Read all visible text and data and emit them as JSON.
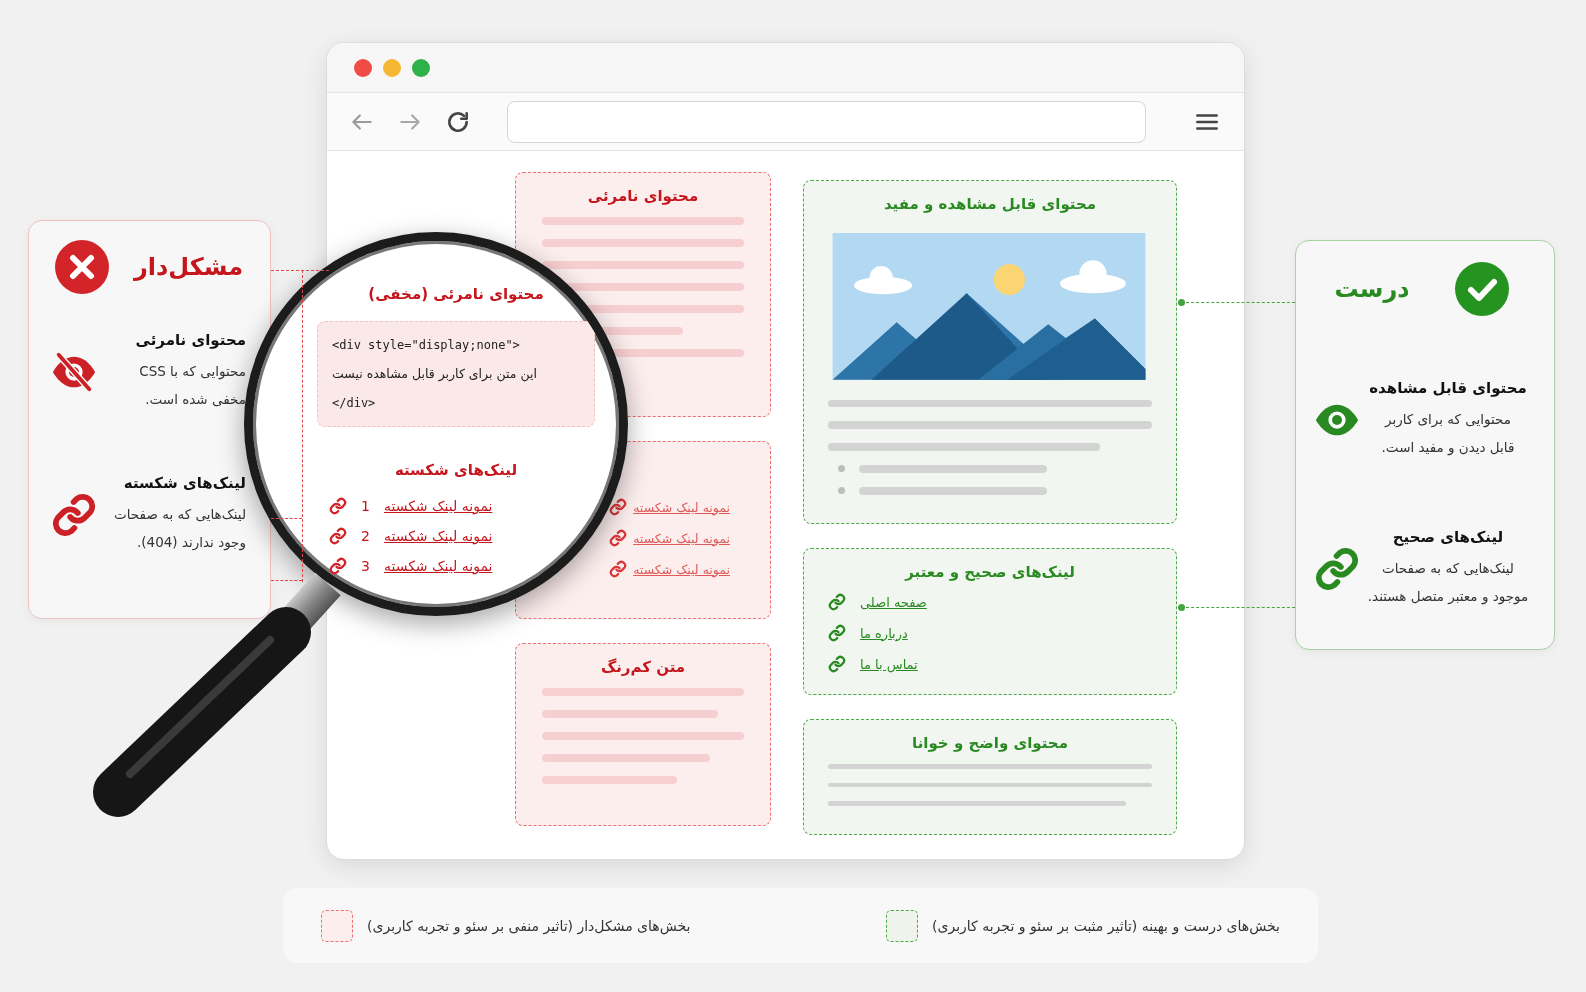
{
  "browser": {
    "traffic_lights": [
      {
        "color": "#ee4c45"
      },
      {
        "color": "#f5b731"
      },
      {
        "color": "#2eb04a"
      }
    ]
  },
  "problem_column": {
    "kind": "problem",
    "cards": [
      {
        "kind": "text",
        "title": "محتوای نامرئی"
      },
      {
        "kind": "links",
        "links": [
          "نمونه لینک شکسته",
          "نمونه لینک شکسته",
          "نمونه لینک شکسته"
        ]
      },
      {
        "kind": "text",
        "title": "متن کم‌رنگ"
      }
    ]
  },
  "good_column": {
    "kind": "ok",
    "cards": [
      {
        "kind": "media",
        "title": "محتوای قابل مشاهده و مفید"
      },
      {
        "kind": "links",
        "title": "لینک‌های صحیح و معتبر",
        "links": [
          "صفحه اصلی",
          "درباره ما",
          "تماس با ما"
        ]
      },
      {
        "kind": "text",
        "title": "محتوای واضح و خوانا"
      }
    ]
  },
  "magnifier": {
    "title": "محتوای نامرئی (مخفی)",
    "code": [
      "<div style=\"display;none\">",
      "این متن برای کاربر قابل مشاهده نیست",
      "</div>"
    ],
    "links_title": "لینک‌های شکسته",
    "links": [
      {
        "text": "نمونه لینک شکسته",
        "number": "1"
      },
      {
        "text": "نمونه لینک شکسته",
        "number": "2"
      },
      {
        "text": "نمونه لینک شکسته",
        "number": "3"
      }
    ]
  },
  "callouts": [
    {
      "kind": "problem",
      "title": "مشکل‌دار",
      "items": [
        {
          "kind": "hidden",
          "title": "محتوای نامرئی",
          "text": "محتوایی که با CSS\nمخفی شده است."
        },
        {
          "kind": "broken-link",
          "title": "لینک‌های شکسته",
          "text": "لینک‌هایی که به صفحات\nوجود ندارند (404)."
        }
      ]
    },
    {
      "kind": "ok",
      "title": "درست",
      "items": [
        {
          "kind": "visible",
          "title": "محتوای قابل مشاهده",
          "text": "محتوایی که برای کاربر\nقابل دیدن و مفید است."
        },
        {
          "kind": "link",
          "title": "لینک‌های صحیح",
          "text": "لینک‌هایی که به صفحات\nموجود و معتبر متصل هستند."
        }
      ]
    }
  ],
  "legend": [
    {
      "kind": "ok",
      "text": "بخش‌های درست و بهینه (تاثیر مثبت بر سئو و تجربه کاربری)"
    },
    {
      "kind": "problem",
      "text": "بخش‌های مشکل‌دار (تاثیر منفی بر سئو و تجربه کاربری)"
    }
  ]
}
